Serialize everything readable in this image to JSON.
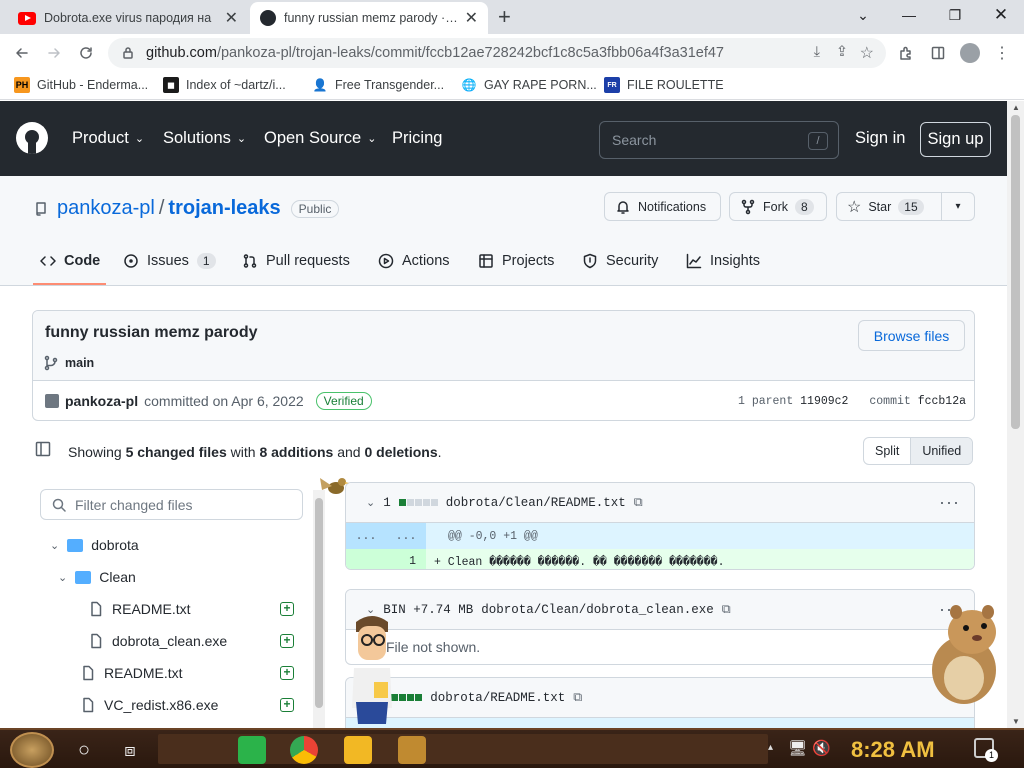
{
  "browser": {
    "tabs": [
      {
        "title": "Dobrota.exe virus пародия на",
        "favicon": "youtube-icon",
        "active": false
      },
      {
        "title": "funny russian memz parody · pa",
        "favicon": "github-icon",
        "active": true
      }
    ],
    "new_tab": "+",
    "url_host": "github.com",
    "url_path": "/pankoza-pl/trojan-leaks/commit/fccb12ae728242bcf1c8c5a3fbb06a4f3a31ef47",
    "bookmarks": [
      {
        "label": "GitHub - Enderma...",
        "icon": "PH",
        "color": "#f7971e"
      },
      {
        "label": "Index of ~dartz/i...",
        "icon": "◼",
        "color": "#1b1b1b"
      },
      {
        "label": "Free Transgender...",
        "icon": "👤",
        "color": "#ffffff"
      },
      {
        "label": "GAY RAPE PORN...",
        "icon": "🌐",
        "color": "#ffffff"
      },
      {
        "label": "FILE ROULETTE",
        "icon": "FR",
        "color": "#1c3fa8"
      }
    ]
  },
  "github_header": {
    "nav": [
      "Product",
      "Solutions",
      "Open Source",
      "Pricing"
    ],
    "search_placeholder": "Search",
    "search_key": "/",
    "sign_in": "Sign in",
    "sign_up": "Sign up"
  },
  "repo": {
    "owner": "pankoza-pl",
    "separator": "/",
    "name": "trojan-leaks",
    "visibility": "Public",
    "notifications": "Notifications",
    "fork": {
      "label": "Fork",
      "count": "8"
    },
    "star": {
      "label": "Star",
      "count": "15"
    },
    "tabs": [
      {
        "label": "Code",
        "count": null,
        "icon": "code-icon"
      },
      {
        "label": "Issues",
        "count": "1",
        "icon": "issue-icon"
      },
      {
        "label": "Pull requests",
        "count": null,
        "icon": "pull-request-icon"
      },
      {
        "label": "Actions",
        "count": null,
        "icon": "actions-icon"
      },
      {
        "label": "Projects",
        "count": null,
        "icon": "projects-icon"
      },
      {
        "label": "Security",
        "count": null,
        "icon": "shield-icon"
      },
      {
        "label": "Insights",
        "count": null,
        "icon": "graph-icon"
      }
    ]
  },
  "commit": {
    "message": "funny russian memz parody",
    "browse_files": "Browse files",
    "branch": "main",
    "author": "pankoza-pl",
    "committed_text": "committed on Apr 6, 2022",
    "verified": "Verified",
    "parent_label": "1 parent",
    "parent_sha": "11909c2",
    "commit_label": "commit",
    "commit_sha": "fccb12a"
  },
  "summary": {
    "showing": "Showing",
    "changed": "5 changed files",
    "with": "with",
    "additions": "8 additions",
    "and": "and",
    "deletions": "0 deletions",
    "period": ".",
    "split": "Split",
    "unified": "Unified"
  },
  "file_tree": {
    "filter_placeholder": "Filter changed files",
    "items": [
      {
        "label": "dobrota",
        "type": "folder"
      },
      {
        "label": "Clean",
        "type": "folder"
      },
      {
        "label": "README.txt",
        "type": "file"
      },
      {
        "label": "dobrota_clean.exe",
        "type": "file"
      },
      {
        "label": "README.txt",
        "type": "file"
      },
      {
        "label": "VC_redist.x86.exe",
        "type": "file"
      }
    ]
  },
  "diffs": [
    {
      "count": "1",
      "path": "dobrota/Clean/README.txt",
      "hunk_dots": "...",
      "hunk": "@@ -0,0 +1 @@",
      "line_no": "1",
      "line": "+ Clean ������ ������. �� ������� �������."
    },
    {
      "count": "BIN +7.74 MB",
      "path": "dobrota/Clean/dobrota_clean.exe",
      "note": "File not shown."
    },
    {
      "count": "",
      "path": "dobrota/README.txt"
    }
  ],
  "taskbar": {
    "time": "8:28 AM",
    "notification_count": "1"
  }
}
